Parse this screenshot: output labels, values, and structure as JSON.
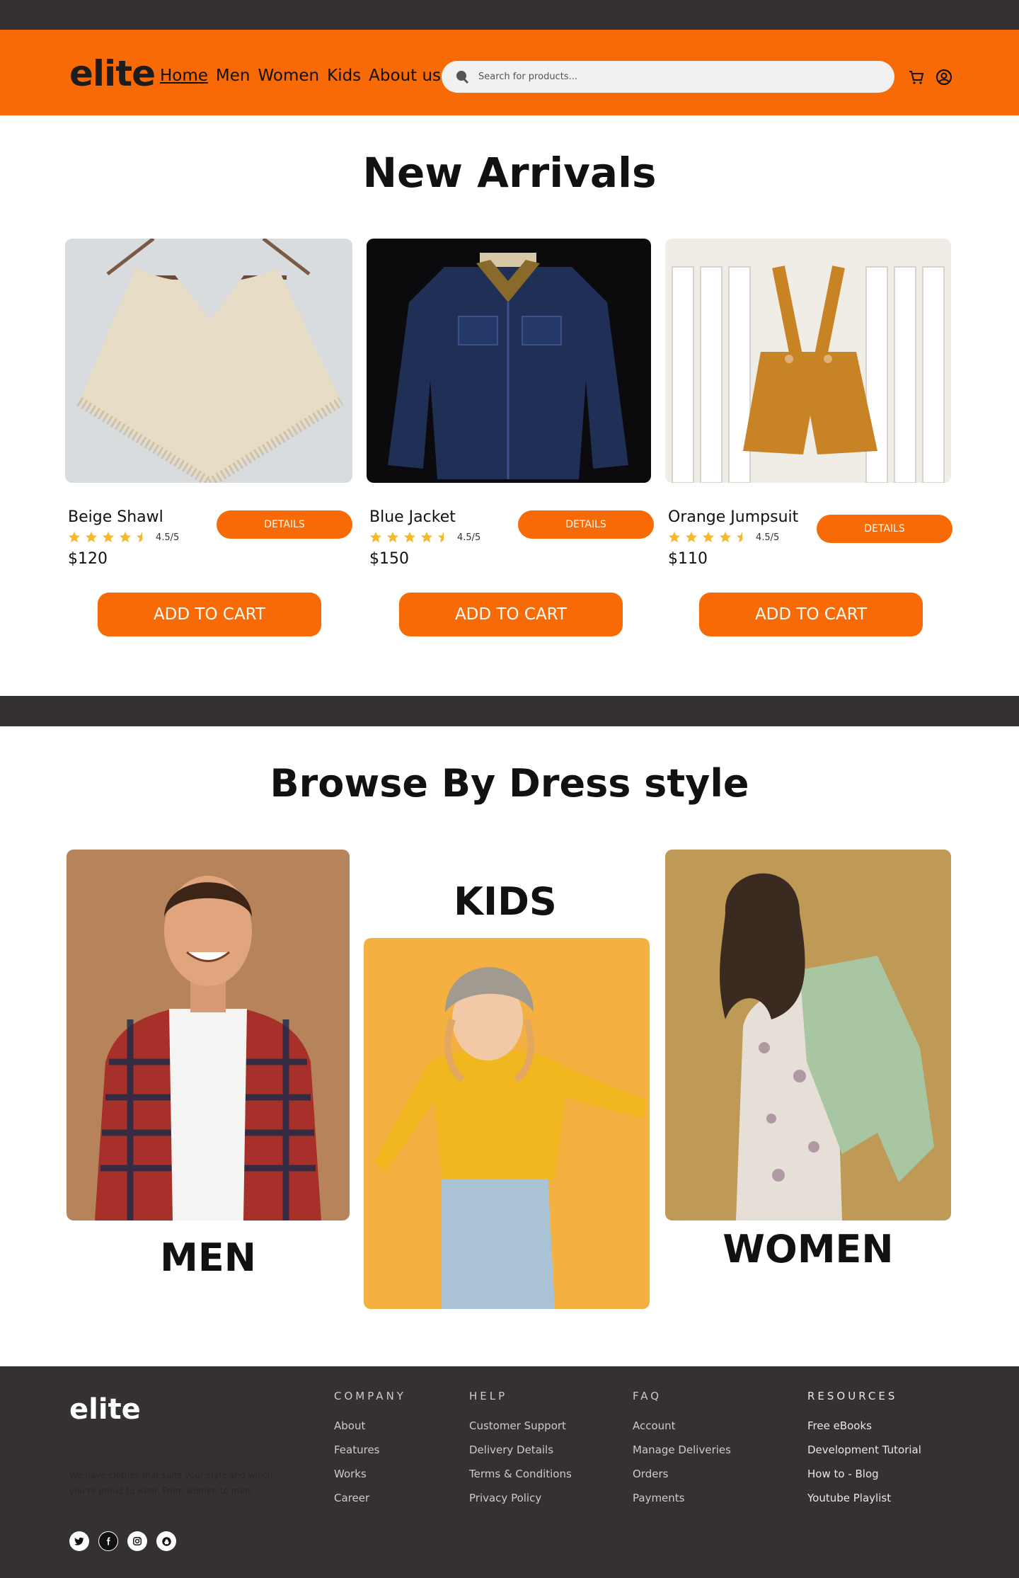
{
  "header": {
    "logo": "elite",
    "nav": [
      "Home",
      "Men",
      "Women",
      "Kids",
      "About us"
    ],
    "search_placeholder": "Search for products..."
  },
  "arrivals": {
    "title": "New Arrivals",
    "details_label": "DETAILS",
    "add_label": "ADD TO CART",
    "products": [
      {
        "name": "Beige Shawl",
        "rating": "4.5/5",
        "stars": 4.5,
        "price": "$120"
      },
      {
        "name": "Blue Jacket",
        "rating": "4.5/5",
        "stars": 4.5,
        "price": "$150"
      },
      {
        "name": "Orange Jumpsuit",
        "rating": "4.5/5",
        "stars": 4.5,
        "price": "$110"
      }
    ]
  },
  "browse": {
    "title": "Browse By Dress style",
    "men": "MEN",
    "kids": "KIDS",
    "women": "WOMEN"
  },
  "footer": {
    "logo": "elite",
    "description": "We have clothes that suits your style and which you're proud to wear. From women to men.",
    "columns": [
      {
        "head": "COMPANY",
        "links": [
          "About",
          "Features",
          "Works",
          "Career"
        ]
      },
      {
        "head": "HELP",
        "links": [
          "Customer Support",
          "Delivery Details",
          "Terms & Conditions",
          "Privacy Policy"
        ]
      },
      {
        "head": "FAQ",
        "links": [
          "Account",
          "Manage Deliveries",
          "Orders",
          "Payments"
        ]
      },
      {
        "head": "RESOURCES",
        "links": [
          "Free eBooks",
          "Development Tutorial",
          "How to - Blog",
          "Youtube Playlist"
        ]
      }
    ],
    "social": [
      "twitter-icon",
      "facebook-icon",
      "instagram-icon",
      "github-icon"
    ]
  },
  "colors": {
    "accent": "#f76a05",
    "dark": "#353031",
    "star": "#f5b82e"
  }
}
